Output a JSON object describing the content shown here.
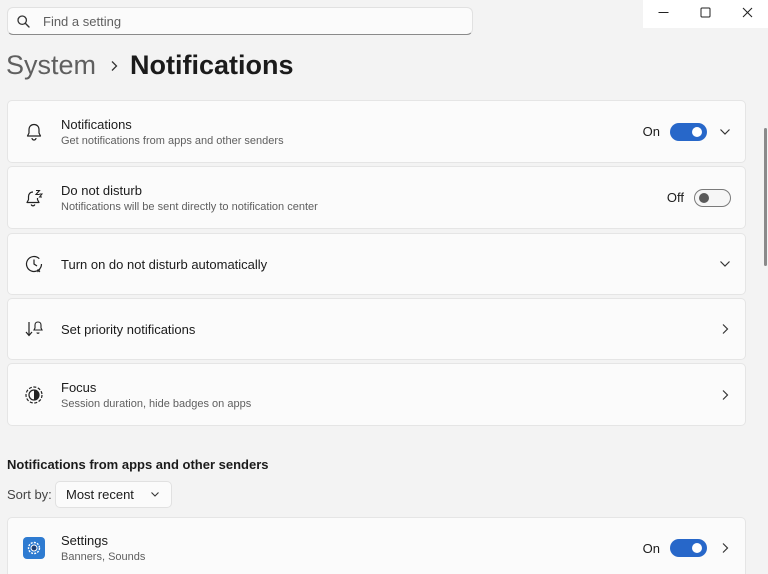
{
  "search": {
    "placeholder": "Find a setting"
  },
  "window_controls": {
    "minimize_icon": "minimize-icon",
    "maximize_icon": "maximize-icon",
    "close_icon": "close-icon"
  },
  "breadcrumb": {
    "parent": "System",
    "current": "Notifications"
  },
  "cards": [
    {
      "icon": "bell-icon",
      "title": "Notifications",
      "subtitle": "Get notifications from apps and other senders",
      "state": "On",
      "toggle": true,
      "chevron": "down"
    },
    {
      "icon": "do-not-disturb-icon",
      "title": "Do not disturb",
      "subtitle": "Notifications will be sent directly to notification center",
      "state": "Off",
      "toggle": false
    },
    {
      "icon": "clock-icon",
      "title": "Turn on do not disturb automatically",
      "chevron": "down"
    },
    {
      "icon": "priority-icon",
      "title": "Set priority notifications",
      "chevron": "right"
    },
    {
      "icon": "focus-icon",
      "title": "Focus",
      "subtitle": "Session duration, hide badges on apps",
      "chevron": "right"
    }
  ],
  "section": {
    "title": "Notifications from apps and other senders"
  },
  "sort": {
    "label": "Sort by:",
    "value": "Most recent"
  },
  "apps": [
    {
      "icon": "settings-app-icon",
      "title": "Settings",
      "subtitle": "Banners, Sounds",
      "state": "On",
      "toggle": true,
      "chevron": "right"
    }
  ],
  "colors": {
    "accent": "#2767c9",
    "background": "#f3f3f3",
    "card": "#fbfbfb"
  }
}
